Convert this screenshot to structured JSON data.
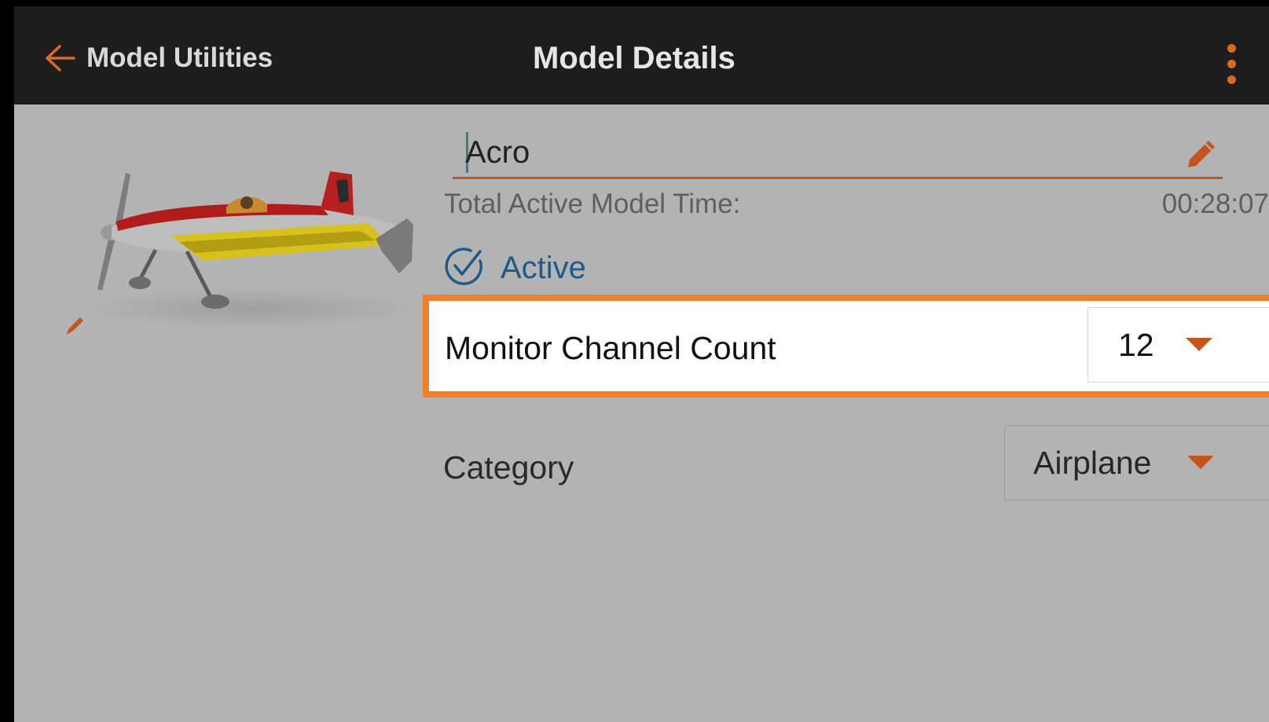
{
  "header": {
    "back_label": "Model Utilities",
    "title": "Model Details",
    "icons": {
      "back": "back-arrow-icon",
      "menu": "more-vert-icon"
    }
  },
  "model": {
    "name": "Acro",
    "total_time_label": "Total Active Model Time:",
    "total_time_value": "00:28:07",
    "active_label": "Active",
    "active_checked": true
  },
  "settings": {
    "channel_count_label": "Monitor Channel Count",
    "channel_count_value": "12",
    "category_label": "Category",
    "category_value": "Airplane"
  },
  "colors": {
    "accent": "#c5561b",
    "highlight": "#f0802f",
    "active_blue": "#1e5a8a",
    "topbar": "#1d1d1d",
    "background": "#b3b3b3"
  }
}
